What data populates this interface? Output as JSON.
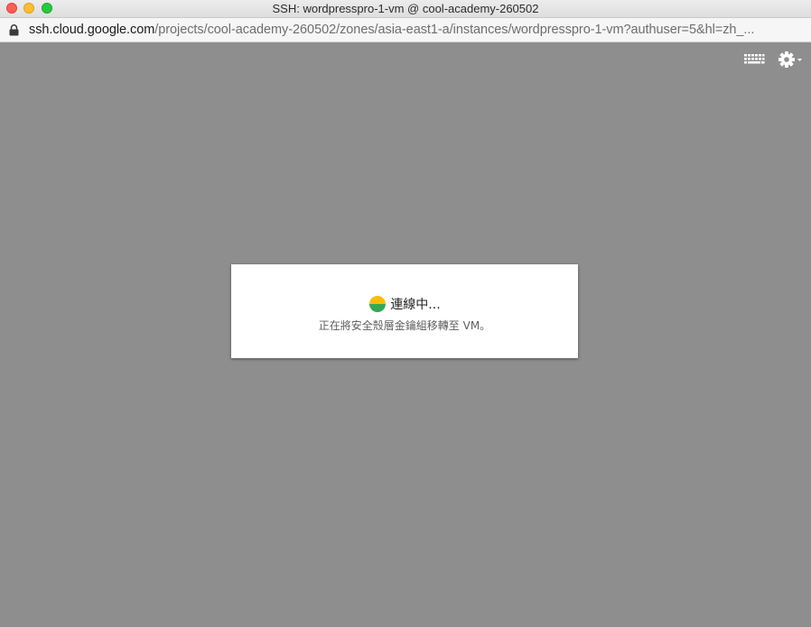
{
  "window": {
    "title": "SSH: wordpresspro-1-vm @ cool-academy-260502"
  },
  "address_bar": {
    "host": "ssh.cloud.google.com",
    "path": "/projects/cool-academy-260502/zones/asia-east1-a/instances/wordpresspro-1-vm?authuser=5&hl=zh_..."
  },
  "toolbar": {
    "keyboard_icon": "keyboard-icon",
    "settings_icon": "gear-icon"
  },
  "dialog": {
    "title": "連線中...",
    "subtitle": "正在將安全殼層金鑰組移轉至 VM。",
    "spinner_colors": [
      "#fbbc04",
      "#34a853"
    ]
  },
  "colors": {
    "terminal_background": "#8e8e8e",
    "dialog_background": "#ffffff"
  }
}
